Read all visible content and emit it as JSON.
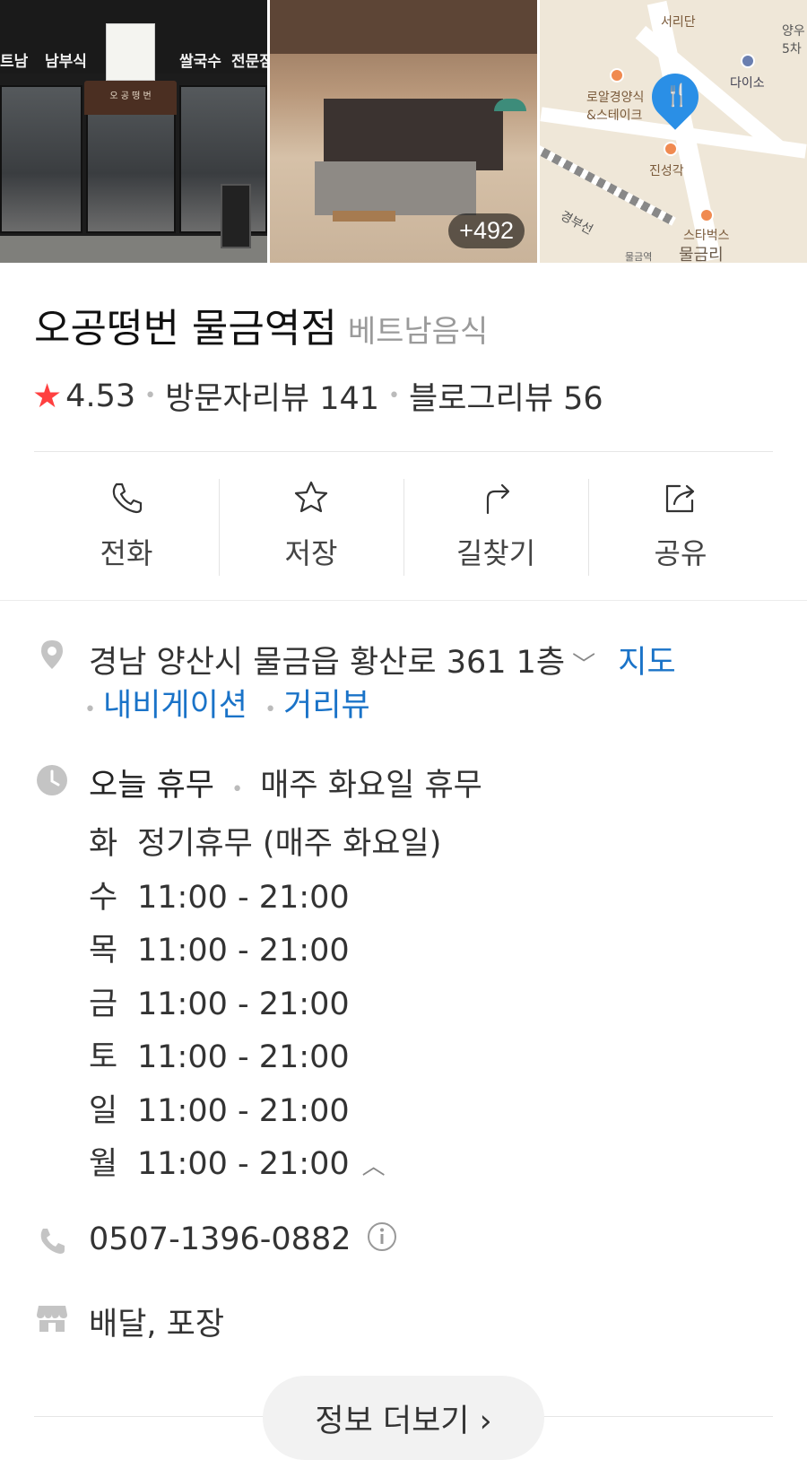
{
  "photos": {
    "count_badge": "+492",
    "storefront": {
      "signs": [
        "트남",
        "남부식",
        "쌀국수",
        "전문점"
      ],
      "awning": "오 공 떵 번"
    },
    "map_labels": [
      "서리단",
      "양우",
      "5차",
      "다이소",
      "로알경양식",
      "&스테이크",
      "진성각",
      "경부선",
      "스타벅스",
      "물금리",
      "물금역"
    ]
  },
  "place": {
    "name": "오공떵번 물금역점",
    "category": "베트남음식",
    "rating": "4.53",
    "visitor_reviews": "방문자리뷰 141",
    "blog_reviews": "블로그리뷰 56"
  },
  "actions": [
    {
      "label": "전화",
      "icon": "phone-icon"
    },
    {
      "label": "저장",
      "icon": "star-icon"
    },
    {
      "label": "길찾기",
      "icon": "directions-icon"
    },
    {
      "label": "공유",
      "icon": "share-icon"
    }
  ],
  "address": {
    "text": "경남 양산시 물금읍 황산로 361 1층",
    "map_link": "지도",
    "navigation_link": "내비게이션",
    "street_view_link": "거리뷰"
  },
  "hours": {
    "status": "오늘 휴무",
    "summary": "매주 화요일 휴무",
    "days": [
      {
        "day": "화",
        "time": "정기휴무 (매주 화요일)"
      },
      {
        "day": "수",
        "time": "11:00 - 21:00"
      },
      {
        "day": "목",
        "time": "11:00 - 21:00"
      },
      {
        "day": "금",
        "time": "11:00 - 21:00"
      },
      {
        "day": "토",
        "time": "11:00 - 21:00"
      },
      {
        "day": "일",
        "time": "11:00 - 21:00"
      },
      {
        "day": "월",
        "time": "11:00 - 21:00"
      }
    ]
  },
  "phone": "0507-1396-0882",
  "services": "배달, 포장",
  "more_button": "정보 더보기 ›",
  "colors": {
    "star": "#ff4040",
    "link": "#1a73c8",
    "map_pin": "#2a8fe6"
  }
}
